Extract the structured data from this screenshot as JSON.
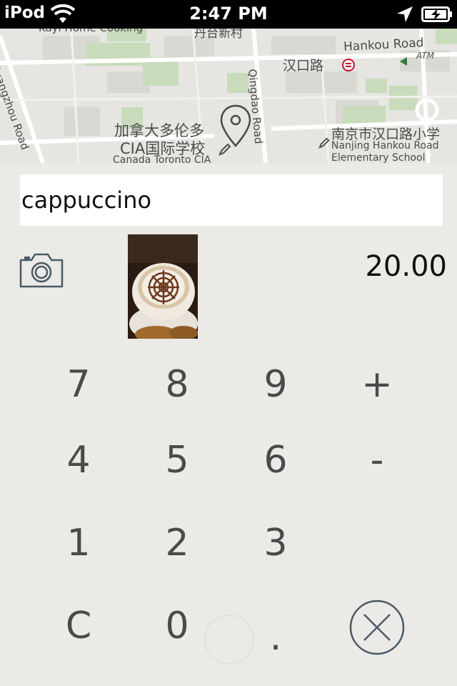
{
  "status_bar": {
    "carrier": "iPod",
    "time": "2:47 PM"
  },
  "map": {
    "labels": {
      "top_left": "Kuyi Home Cooking",
      "top_center": "丹台新村",
      "hankou_road_en": "Hankou Road",
      "hankou_road_cn": "汉口路",
      "atm": "ATM",
      "qingdao_road": "Qingdao Road",
      "left_road": "Guangzhou Road",
      "school_cn_1": "加拿大多伦多",
      "school_cn_2": "CIA国际学校",
      "school_en": "Canada Toronto CIA",
      "right_school_cn": "南京市汉口路小学",
      "right_school_en_1": "Nanjing Hankou Road",
      "right_school_en_2": "Elementary School"
    }
  },
  "entry": {
    "name_value": "cappuccino",
    "amount": "20.00"
  },
  "keypad": {
    "k7": "7",
    "k8": "8",
    "k9": "9",
    "plus": "+",
    "k4": "4",
    "k5": "5",
    "k6": "6",
    "minus": "-",
    "k1": "1",
    "k2": "2",
    "k3": "3",
    "clear": "C",
    "k0": "0",
    "dot": "."
  },
  "colors": {
    "background": "#ebeae6",
    "key_text": "#4a4a4a",
    "icon_stroke": "#4a5a66"
  }
}
